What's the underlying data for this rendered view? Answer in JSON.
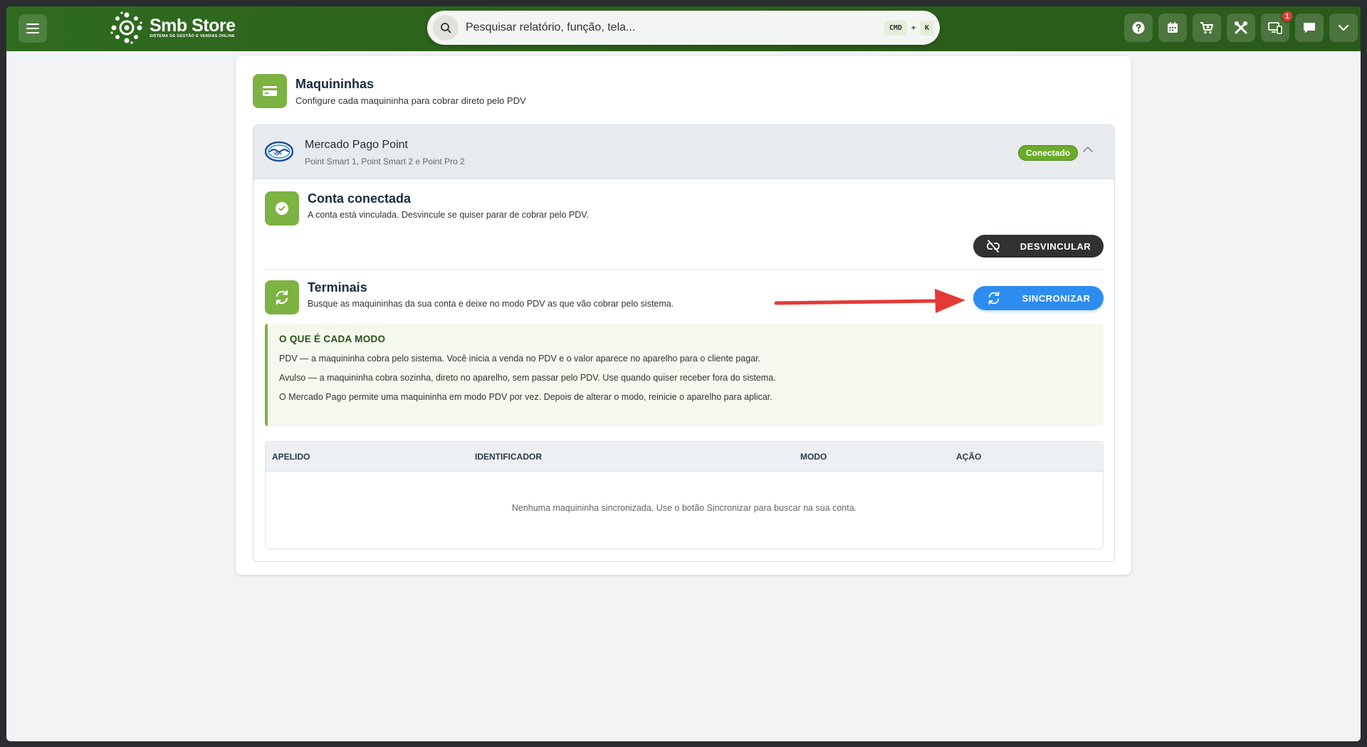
{
  "app": {
    "brand_name": "Smb Store",
    "brand_tagline": "SISTEMA DE GESTÃO E VENDAS ONLINE"
  },
  "search": {
    "placeholder": "Pesquisar relatório, função, tela...",
    "shortcut_key1": "CMD",
    "shortcut_plus": "+",
    "shortcut_key2": "K"
  },
  "topbar_icons": [
    "help-icon",
    "calendar-icon",
    "cart-icon",
    "tools-icon",
    "devices-icon",
    "chat-icon",
    "chevron-down-icon"
  ],
  "notifications": {
    "count": "1"
  },
  "page": {
    "title": "Maquininhas",
    "description": "Configure cada maquininha para cobrar direto pelo PDV"
  },
  "provider": {
    "name": "Mercado Pago Point",
    "models": "Point Smart 1, Point Smart 2 e Point Pro 2",
    "status": "Conectado"
  },
  "account": {
    "title": "Conta conectada",
    "description": "A conta está vinculada. Desvincule se quiser parar de cobrar pelo PDV.",
    "unlink_label": "DESVINCULAR"
  },
  "terminals": {
    "title": "Terminais",
    "description": "Busque as maquininhas da sua conta e deixe no modo PDV as que vão cobrar pelo sistema.",
    "sync_label": "SINCRONIZAR"
  },
  "info": {
    "title": "O QUE É CADA MODO",
    "lines": [
      "PDV — a maquininha cobra pelo sistema. Você inicia a venda no PDV e o valor aparece no aparelho para o cliente pagar.",
      "Avulso — a maquininha cobra sozinha, direto no aparelho, sem passar pelo PDV. Use quando quiser receber fora do sistema.",
      "O Mercado Pago permite uma maquininha em modo PDV por vez. Depois de alterar o modo, reinicie o aparelho para aplicar."
    ]
  },
  "table": {
    "columns": [
      "APELIDO",
      "IDENTIFICADOR",
      "MODO",
      "AÇÃO"
    ],
    "empty_message": "Nenhuma maquininha sincronizada. Use o botão Sincronizar para buscar na sua conta."
  },
  "colors": {
    "topbar": "#2b5f1b",
    "accent_green": "#7cb342",
    "status_green": "#6aaa2a",
    "sync_blue": "#2d8cf0",
    "dark_button": "#2f3133",
    "annotation_arrow": "#e53935"
  }
}
